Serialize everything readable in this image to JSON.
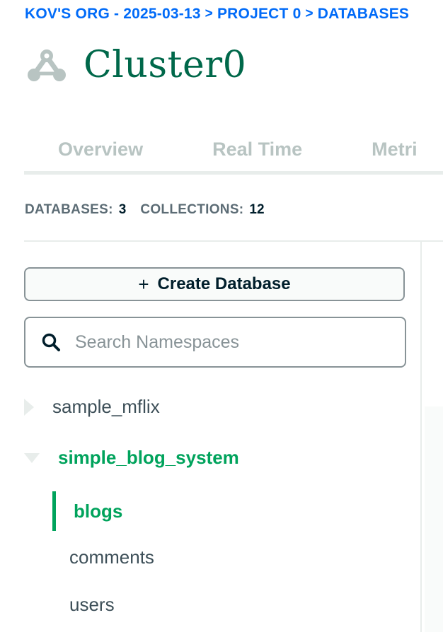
{
  "breadcrumb": {
    "org": "KOV'S ORG - 2025-03-13",
    "project": "PROJECT 0",
    "section": "DATABASES",
    "separator": ">"
  },
  "cluster": {
    "title": "Cluster0",
    "icon": "cluster-icon",
    "title_color": "#00684a"
  },
  "tabs": [
    {
      "label": "Overview"
    },
    {
      "label": "Real Time"
    },
    {
      "label": "Metri"
    }
  ],
  "stats": {
    "databases_label": "DATABASES:",
    "databases_count": "3",
    "collections_label": "COLLECTIONS:",
    "collections_count": "12"
  },
  "create_button": {
    "plus": "+",
    "label": "Create Database"
  },
  "search": {
    "placeholder": "Search Namespaces",
    "value": "",
    "icon": "search-icon"
  },
  "tree": {
    "databases": [
      {
        "name": "sample_mflix",
        "expanded": false
      },
      {
        "name": "simple_blog_system",
        "expanded": true,
        "collections": [
          {
            "name": "blogs",
            "active": true
          },
          {
            "name": "comments",
            "active": false
          },
          {
            "name": "users",
            "active": false
          }
        ]
      }
    ]
  },
  "colors": {
    "link_blue": "#016bf8",
    "active_green": "#00a35c",
    "brand_dark_green": "#00684a"
  }
}
